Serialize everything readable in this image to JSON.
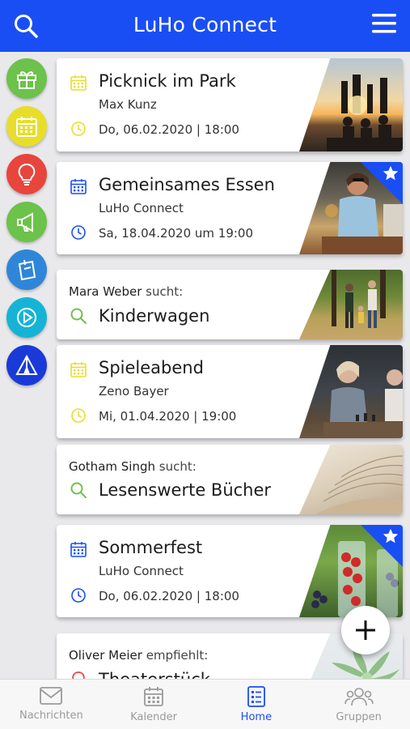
{
  "header": {
    "title": "LuHo Connect",
    "search_icon": "search-icon",
    "menu_icon": "hamburger-menu-icon"
  },
  "colors": {
    "brand": "#1a4ef5",
    "calendar_yellow": "#e8de2a",
    "search_green": "#6cc24a",
    "star_ribbon": "#1a4ef5"
  },
  "categories": [
    {
      "icon": "gift-icon",
      "color": "#6cc24a"
    },
    {
      "icon": "calendar-icon",
      "color": "#e8de2a"
    },
    {
      "icon": "lightbulb-icon",
      "color": "#e8453c"
    },
    {
      "icon": "megaphone-icon",
      "color": "#6cc24a"
    },
    {
      "icon": "note-icon",
      "color": "#2f86d8"
    },
    {
      "icon": "play-icon",
      "color": "#15b4d6"
    },
    {
      "icon": "tent-icon",
      "color": "#1a3ad8"
    }
  ],
  "feed": {
    "card1": {
      "title": "Picknick im Park",
      "organizer": "Max Kunz",
      "date": "Do, 06.02.2020 | 18:00"
    },
    "card2": {
      "title": "Gemeinsames Essen",
      "organizer": "LuHo Connect",
      "date": "Sa, 18.04.2020 um 19:00"
    },
    "card3": {
      "person": "Mara Weber",
      "verb": "sucht:",
      "item": "Kinderwagen"
    },
    "card4": {
      "title": "Spieleabend",
      "organizer": "Zeno Bayer",
      "date": "Mi, 01.04.2020 | 19:00"
    },
    "card5": {
      "person": "Gotham Singh",
      "verb": "sucht:",
      "item": "Lesenswerte Bücher"
    },
    "card6": {
      "title": "Sommerfest",
      "organizer": "LuHo Connect",
      "date": "Do, 06.02.2020 | 18:00"
    },
    "card7": {
      "person": "Oliver Meier",
      "verb": "empfiehlt:",
      "item": "Theaterstück"
    }
  },
  "fab": {
    "icon": "plus-icon"
  },
  "bottom_nav": {
    "tab1": "Nachrichten",
    "tab2": "Kalender",
    "tab3": "Home",
    "tab4": "Gruppen",
    "active": "Home"
  }
}
